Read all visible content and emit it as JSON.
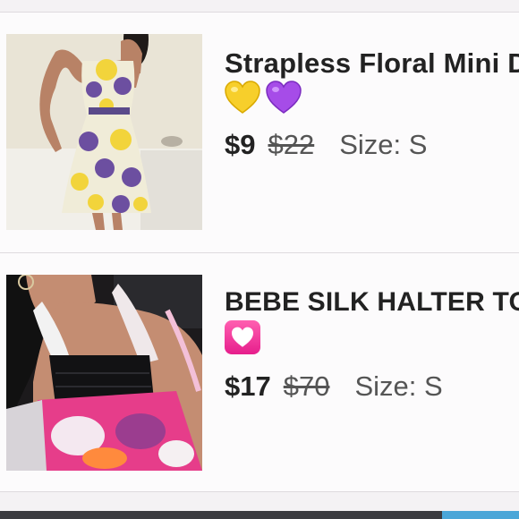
{
  "listings": [
    {
      "title": "Strapless Floral Mini D",
      "emojis": [
        "yellow-heart",
        "purple-heart"
      ],
      "price": "$9",
      "original_price": "$22",
      "size": "Size: S"
    },
    {
      "title": "BEBE SILK HALTER TO",
      "emojis": [
        "heart-decoration"
      ],
      "price": "$17",
      "original_price": "$70",
      "size": "Size: S"
    }
  ],
  "colors": {
    "background": "#f4f2f4",
    "card": "#fcfbfc",
    "bottom_bar": "#3b3b40",
    "bottom_accent": "#4aa6d8"
  }
}
